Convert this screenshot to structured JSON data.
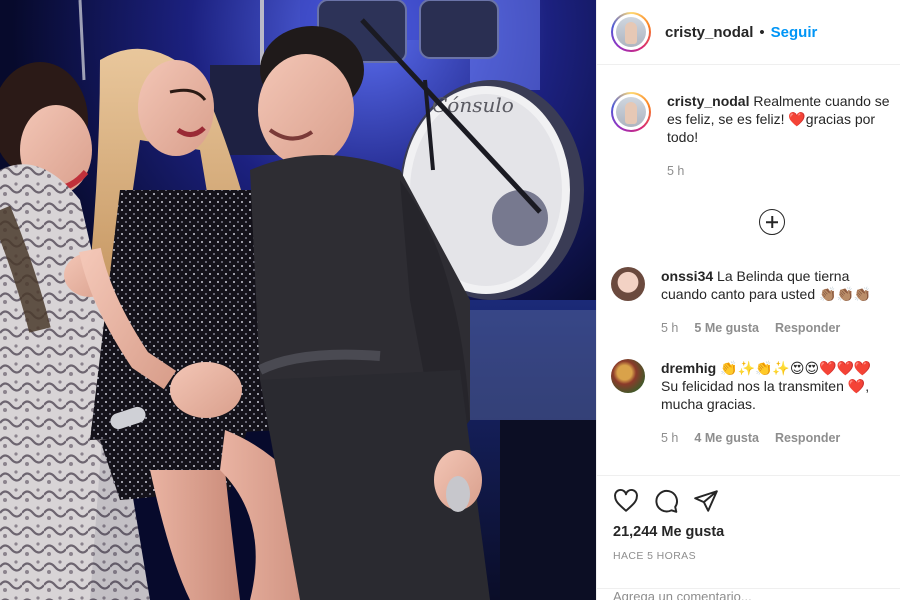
{
  "header": {
    "username": "cristy_nodal",
    "separator": "•",
    "follow_label": "Seguir"
  },
  "caption": {
    "username": "cristy_nodal",
    "text": "Realmente cuando se es feliz, se es feliz! ❤️gracias por todo!",
    "time": "5 h"
  },
  "comments": [
    {
      "username": "onssi34",
      "text": "La Belinda que tierna cuando canto para usted 👏🏽👏🏽👏🏽",
      "time": "5 h",
      "likes": "5 Me gusta",
      "reply": "Responder"
    },
    {
      "username": "dremhig",
      "text": "👏✨👏✨😍😍❤️❤️❤️Su felicidad nos la transmiten ❤️, mucha gracias.",
      "time": "5 h",
      "likes": "4 Me gusta",
      "reply": "Responder"
    }
  ],
  "likes_count": "21,244 Me gusta",
  "posted_ago": "HACE 5 HORAS",
  "add_comment_placeholder": "Agrega un comentario...",
  "drum_logo": "Cónsulo",
  "icons": {
    "like": "heart-icon",
    "comment": "comment-icon",
    "share": "send-icon",
    "load_more": "plus-circle-icon"
  },
  "colors": {
    "link": "#0095f6",
    "text": "#262626",
    "secondary": "#8e8e8e",
    "border": "#efefef"
  }
}
